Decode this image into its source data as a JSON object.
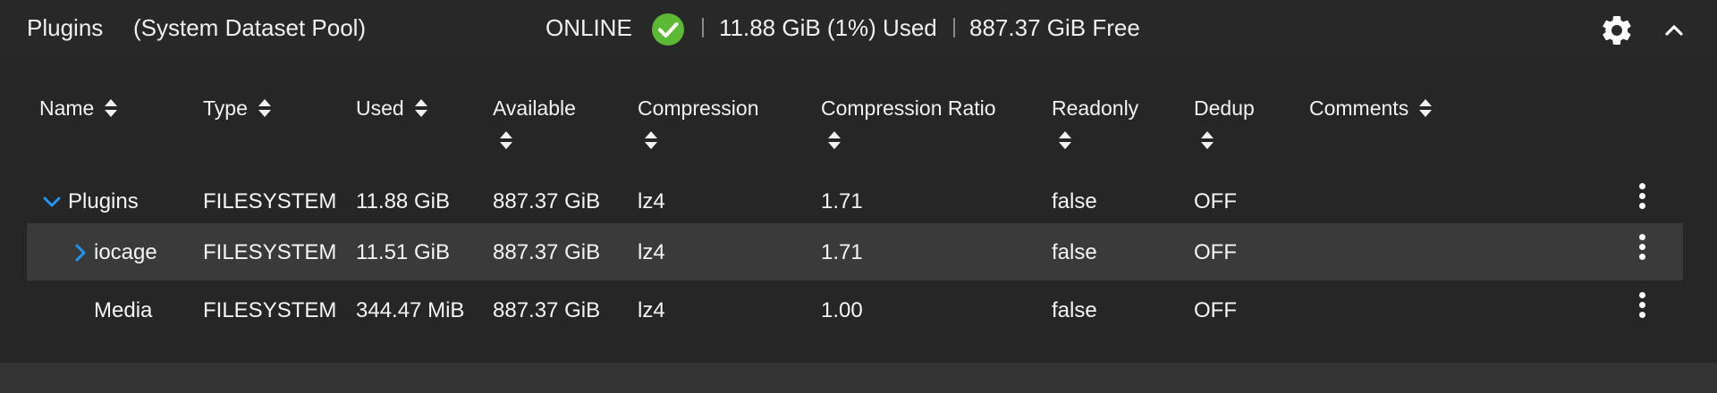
{
  "header": {
    "pool_name": "Plugins",
    "pool_role": "(System Dataset Pool)",
    "status": "ONLINE",
    "status_icon": "check-circle-icon",
    "status_color": "#5cb934",
    "used": "11.88 GiB (1%) Used",
    "free": "887.37 GiB Free",
    "separator": "|",
    "settings_icon": "gear-icon",
    "collapse_icon": "chevron-up-icon"
  },
  "table": {
    "columns": [
      {
        "label": "Name"
      },
      {
        "label": "Type"
      },
      {
        "label": "Used"
      },
      {
        "label": "Available"
      },
      {
        "label": "Compression"
      },
      {
        "label": "Compression Ratio"
      },
      {
        "label": "Readonly"
      },
      {
        "label": "Dedup"
      },
      {
        "label": "Comments"
      }
    ],
    "rows": [
      {
        "name": "Plugins",
        "expanded": true,
        "level": 0,
        "type": "FILESYSTEM",
        "used": "11.88 GiB",
        "available": "887.37 GiB",
        "compression": "lz4",
        "ratio": "1.71",
        "readonly": "false",
        "dedup": "OFF",
        "comments": ""
      },
      {
        "name": "iocage",
        "expanded": false,
        "level": 1,
        "type": "FILESYSTEM",
        "used": "11.51 GiB",
        "available": "887.37 GiB",
        "compression": "lz4",
        "ratio": "1.71",
        "readonly": "false",
        "dedup": "OFF",
        "comments": ""
      },
      {
        "name": "Media",
        "level": 1,
        "type": "FILESYSTEM",
        "used": "344.47 MiB",
        "available": "887.37 GiB",
        "compression": "lz4",
        "ratio": "1.00",
        "readonly": "false",
        "dedup": "OFF",
        "comments": ""
      }
    ]
  },
  "colors": {
    "accent": "#2196f3",
    "panel": "#262626",
    "row_highlight": "#3a3a3a"
  },
  "icons": {
    "sort": "sort-icon",
    "expand_down": "chevron-down-icon",
    "expand_right": "chevron-right-icon",
    "row_actions": "more-vert-icon"
  }
}
